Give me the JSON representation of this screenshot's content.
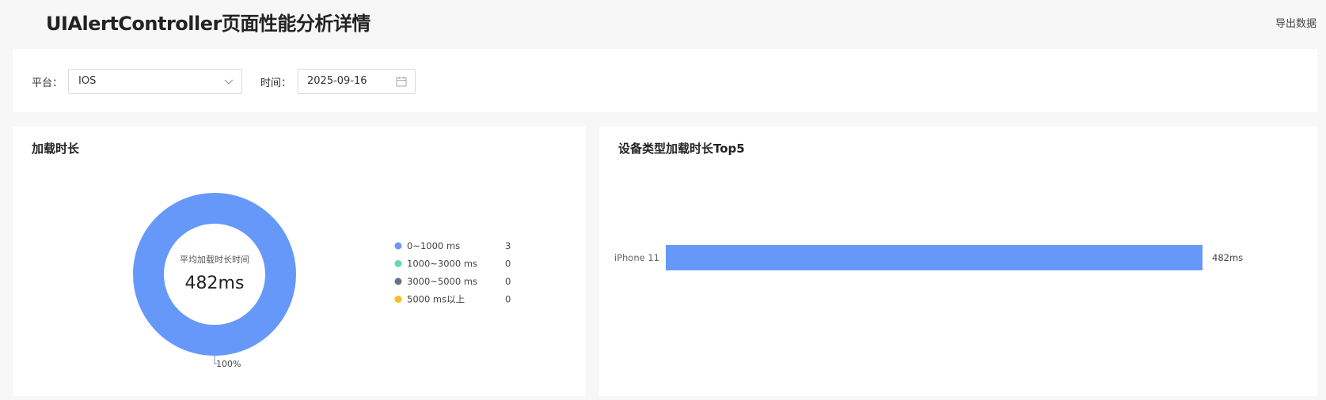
{
  "header": {
    "title": "UIAlertController页面性能分析详情",
    "export_label": "导出数据"
  },
  "filters": {
    "platform_label": "平台：",
    "platform_value": "IOS",
    "time_label": "时间：",
    "date_value": "2025-09-16"
  },
  "colors": {
    "accent": "#6698fa",
    "teal": "#62dab0",
    "slate": "#63738f",
    "yellow": "#f6c022"
  },
  "load_card": {
    "title": "加载时长",
    "center_label": "平均加载时长时间",
    "center_value": "482ms",
    "slice_label": "100%"
  },
  "device_card": {
    "title": "设备类型加载时长Top5"
  },
  "chart_data": [
    {
      "type": "pie",
      "title": "加载时长",
      "categories": [
        "0~1000 ms",
        "1000~3000 ms",
        "3000~5000 ms",
        "5000 ms以上"
      ],
      "values": [
        3,
        0,
        0,
        0
      ],
      "colors": [
        "#6698fa",
        "#62dab0",
        "#63738f",
        "#f6c022"
      ],
      "legend": "right"
    },
    {
      "type": "bar",
      "orientation": "horizontal",
      "title": "设备类型加载时长Top5",
      "categories": [
        "iPhone 11"
      ],
      "values": [
        482
      ],
      "value_labels": [
        "482ms"
      ],
      "color": "#6698fa"
    }
  ]
}
